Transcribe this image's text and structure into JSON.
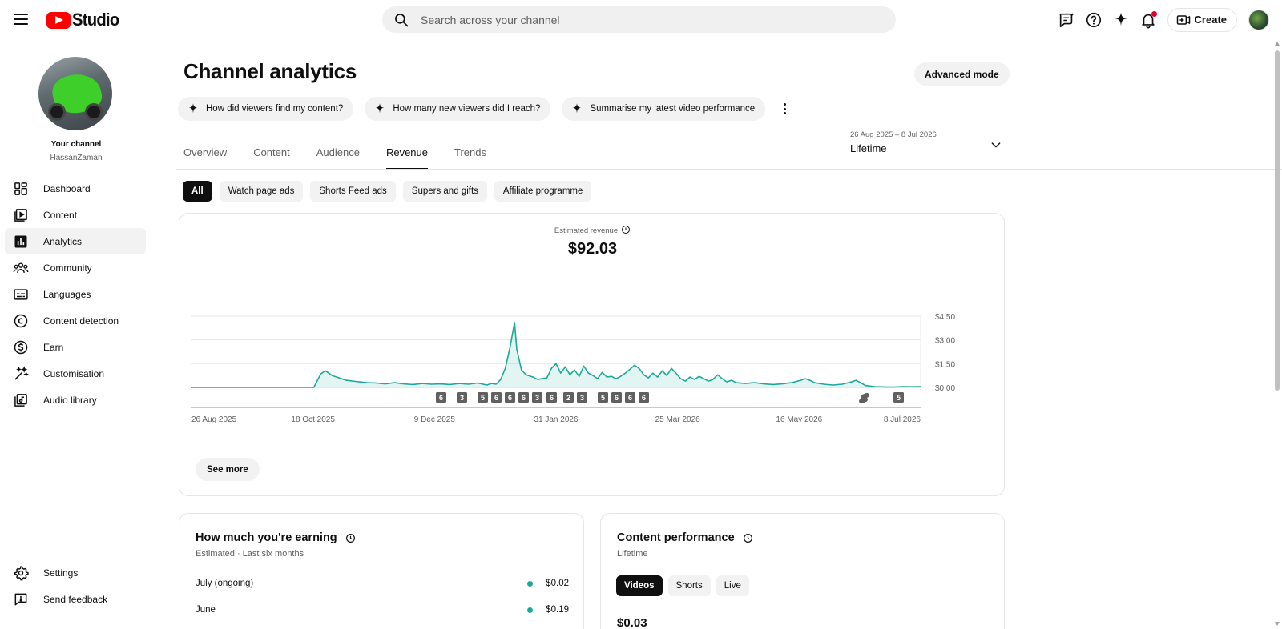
{
  "header": {
    "logo_text": "Studio",
    "search_placeholder": "Search across your channel",
    "create_label": "Create"
  },
  "sidebar": {
    "channel_title": "Your channel",
    "channel_handle": "HassanZaman",
    "items": [
      {
        "label": "Dashboard",
        "icon": "dashboard-icon"
      },
      {
        "label": "Content",
        "icon": "content-icon"
      },
      {
        "label": "Analytics",
        "icon": "analytics-icon",
        "active": true
      },
      {
        "label": "Community",
        "icon": "community-icon"
      },
      {
        "label": "Languages",
        "icon": "languages-icon"
      },
      {
        "label": "Content detection",
        "icon": "copyright-icon"
      },
      {
        "label": "Earn",
        "icon": "earn-icon"
      },
      {
        "label": "Customisation",
        "icon": "customisation-icon"
      },
      {
        "label": "Audio library",
        "icon": "audio-library-icon"
      }
    ],
    "bottom_items": [
      {
        "label": "Settings",
        "icon": "gear-icon"
      },
      {
        "label": "Send feedback",
        "icon": "feedback-icon"
      }
    ]
  },
  "main": {
    "title": "Channel analytics",
    "advanced_mode_label": "Advanced mode",
    "prompts": [
      "How did viewers find my content?",
      "How many new viewers did I reach?",
      "Summarise my latest video performance"
    ],
    "tabs": [
      "Overview",
      "Content",
      "Audience",
      "Revenue",
      "Trends"
    ],
    "active_tab": "Revenue",
    "date_range": {
      "range": "26 Aug 2025 – 8 Jul 2026",
      "label": "Lifetime"
    },
    "revenue_chips": [
      "All",
      "Watch page ads",
      "Shorts Feed ads",
      "Supers and gifts",
      "Affiliate programme"
    ],
    "active_chip": "All",
    "revenue_card": {
      "metric_label": "Estimated revenue",
      "metric_value": "$92.03",
      "see_more_label": "See more"
    },
    "earning_card": {
      "title": "How much you're earning",
      "subtitle": "Estimated · Last six months",
      "rows": [
        {
          "month": "July (ongoing)",
          "value": "$0.02"
        },
        {
          "month": "June",
          "value": "$0.19"
        }
      ],
      "dot_color": "#1ba998"
    },
    "performance_card": {
      "title": "Content performance",
      "subtitle": "Lifetime",
      "tabs": [
        "Videos",
        "Shorts",
        "Live"
      ],
      "active_tab": "Videos",
      "value": "$0.03"
    }
  },
  "chart_data": {
    "type": "area",
    "series_color": "#1ba998",
    "x_tick_labels": [
      "26 Aug 2025",
      "18 Oct 2025",
      "9 Dec 2025",
      "31 Jan 2026",
      "25 Mar 2026",
      "16 May 2026",
      "8 Jul 2026"
    ],
    "y_tick_labels": [
      "$4.50",
      "$3.00",
      "$1.50",
      "$0.00"
    ],
    "y_ticks": [
      4.5,
      3.0,
      1.5,
      0.0
    ],
    "ylim": [
      0,
      4.5
    ],
    "x_range_days": [
      0,
      316
    ],
    "points": [
      [
        0,
        0.0
      ],
      [
        53,
        0.0
      ],
      [
        56,
        0.85
      ],
      [
        58,
        1.05
      ],
      [
        61,
        0.75
      ],
      [
        64,
        0.6
      ],
      [
        67,
        0.45
      ],
      [
        71,
        0.38
      ],
      [
        76,
        0.3
      ],
      [
        80,
        0.28
      ],
      [
        84,
        0.22
      ],
      [
        88,
        0.3
      ],
      [
        92,
        0.22
      ],
      [
        96,
        0.18
      ],
      [
        100,
        0.25
      ],
      [
        104,
        0.2
      ],
      [
        108,
        0.22
      ],
      [
        112,
        0.18
      ],
      [
        116,
        0.25
      ],
      [
        120,
        0.2
      ],
      [
        124,
        0.28
      ],
      [
        128,
        0.15
      ],
      [
        130,
        0.25
      ],
      [
        132,
        0.2
      ],
      [
        134,
        0.5
      ],
      [
        136,
        1.2
      ],
      [
        138,
        2.5
      ],
      [
        140,
        4.1
      ],
      [
        141,
        2.4
      ],
      [
        143,
        1.1
      ],
      [
        145,
        0.8
      ],
      [
        148,
        0.65
      ],
      [
        150,
        0.5
      ],
      [
        152,
        0.55
      ],
      [
        154,
        0.6
      ],
      [
        156,
        1.2
      ],
      [
        158,
        1.5
      ],
      [
        160,
        0.9
      ],
      [
        162,
        1.3
      ],
      [
        164,
        0.8
      ],
      [
        166,
        1.1
      ],
      [
        168,
        0.7
      ],
      [
        170,
        1.35
      ],
      [
        172,
        0.9
      ],
      [
        174,
        0.75
      ],
      [
        176,
        0.55
      ],
      [
        178,
        0.95
      ],
      [
        180,
        0.65
      ],
      [
        182,
        0.7
      ],
      [
        184,
        0.55
      ],
      [
        186,
        0.7
      ],
      [
        188,
        0.9
      ],
      [
        190,
        1.15
      ],
      [
        192,
        1.4
      ],
      [
        194,
        1.2
      ],
      [
        196,
        0.8
      ],
      [
        198,
        0.6
      ],
      [
        200,
        0.9
      ],
      [
        202,
        0.65
      ],
      [
        204,
        1.05
      ],
      [
        206,
        0.75
      ],
      [
        208,
        1.2
      ],
      [
        210,
        0.9
      ],
      [
        212,
        0.55
      ],
      [
        214,
        0.4
      ],
      [
        216,
        0.65
      ],
      [
        218,
        0.5
      ],
      [
        220,
        0.7
      ],
      [
        222,
        0.55
      ],
      [
        224,
        0.4
      ],
      [
        226,
        0.5
      ],
      [
        228,
        0.8
      ],
      [
        230,
        0.55
      ],
      [
        232,
        0.35
      ],
      [
        234,
        0.45
      ],
      [
        236,
        0.3
      ],
      [
        240,
        0.25
      ],
      [
        244,
        0.3
      ],
      [
        248,
        0.22
      ],
      [
        252,
        0.18
      ],
      [
        256,
        0.22
      ],
      [
        260,
        0.3
      ],
      [
        264,
        0.45
      ],
      [
        266,
        0.55
      ],
      [
        268,
        0.45
      ],
      [
        270,
        0.3
      ],
      [
        274,
        0.2
      ],
      [
        278,
        0.15
      ],
      [
        282,
        0.2
      ],
      [
        286,
        0.35
      ],
      [
        288,
        0.45
      ],
      [
        290,
        0.3
      ],
      [
        292,
        0.12
      ],
      [
        296,
        0.05
      ],
      [
        300,
        0.03
      ],
      [
        304,
        0.02
      ],
      [
        308,
        0.05
      ],
      [
        312,
        0.04
      ],
      [
        316,
        0.05
      ]
    ],
    "markers": [
      {
        "label": "6"
      },
      {
        "label": "3"
      },
      {
        "label": "5"
      },
      {
        "label": "6"
      },
      {
        "label": "6"
      },
      {
        "label": "6"
      },
      {
        "label": "3"
      },
      {
        "label": "6"
      },
      {
        "label": "2"
      },
      {
        "label": "3"
      },
      {
        "label": "5"
      },
      {
        "label": "6"
      },
      {
        "label": "6"
      },
      {
        "label": "6"
      },
      {
        "label": "shorts"
      },
      {
        "label": "5"
      }
    ]
  }
}
